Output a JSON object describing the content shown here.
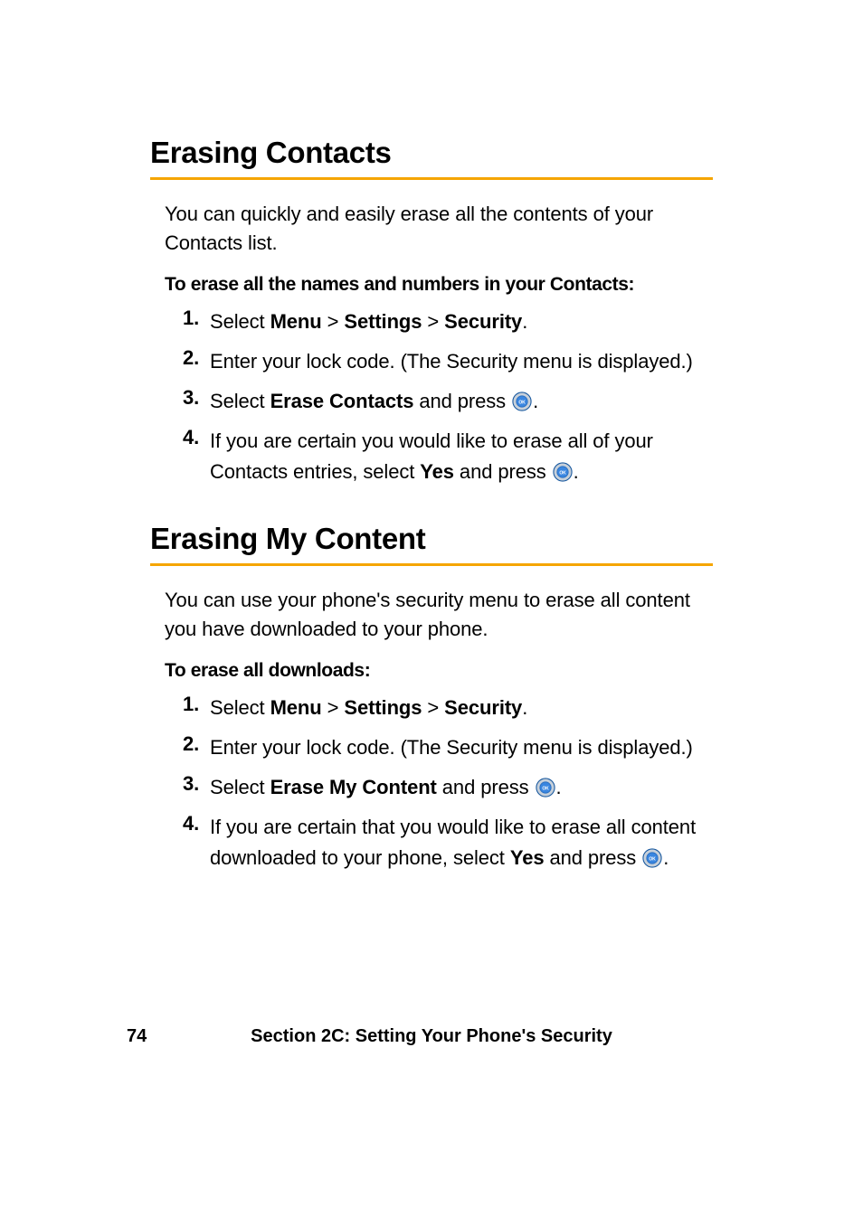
{
  "section_a": {
    "title": "Erasing Contacts",
    "intro": "You can quickly and easily erase all the contents of your Contacts list.",
    "instr": "To erase all the names and numbers in your Contacts:",
    "steps": {
      "s1": {
        "num": "1.",
        "pre": "Select ",
        "menu": "Menu",
        "gt1": " > ",
        "settings": "Settings",
        "gt2": " > ",
        "security": "Security",
        "post": "."
      },
      "s2": {
        "num": "2.",
        "text": "Enter your lock code. (The Security menu is displayed.)"
      },
      "s3": {
        "num": "3.",
        "pre": "Select ",
        "erase": "Erase Contacts",
        "mid": " and press ",
        "post": "."
      },
      "s4": {
        "num": "4.",
        "pre": "If you are certain you would like to erase all of your Contacts entries, select ",
        "yes": "Yes",
        "mid": " and press ",
        "post": "."
      }
    }
  },
  "section_b": {
    "title": "Erasing My Content",
    "intro": "You can use your phone's security menu to erase all content you have downloaded to your phone.",
    "instr": "To erase all downloads:",
    "steps": {
      "s1": {
        "num": "1.",
        "pre": "Select ",
        "menu": "Menu",
        "gt1": " > ",
        "settings": "Settings",
        "gt2": " > ",
        "security": "Security",
        "post": "."
      },
      "s2": {
        "num": "2.",
        "text": "Enter your lock code. (The Security menu is displayed.)"
      },
      "s3": {
        "num": "3.",
        "pre": "Select ",
        "erase": "Erase My Content",
        "mid": " and press ",
        "post": "."
      },
      "s4": {
        "num": "4.",
        "pre": "If you are certain that you would like to erase all content downloaded to your phone, select ",
        "yes": "Yes",
        "mid": " and press ",
        "post": "."
      }
    }
  },
  "footer": {
    "page": "74",
    "section": "Section 2C: Setting Your Phone's Security"
  }
}
